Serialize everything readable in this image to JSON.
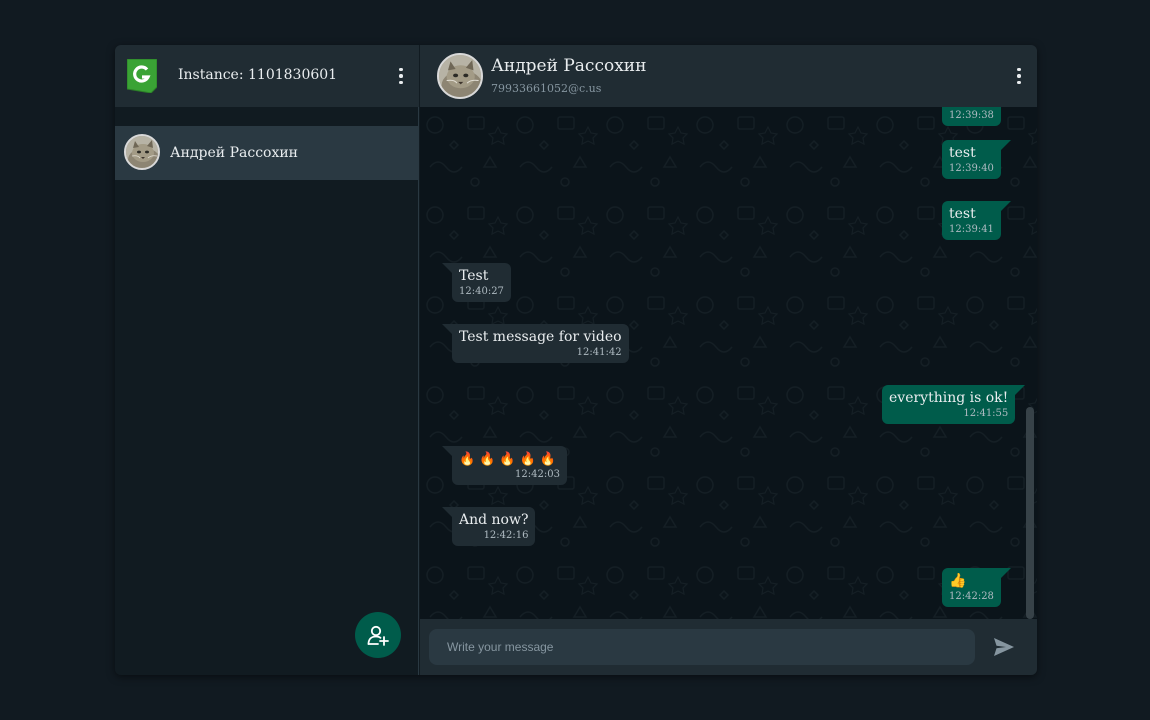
{
  "sidebar": {
    "instance_label": "Instance: 1101830601",
    "logo_icon": "green-api-logo",
    "menu_icon": "kebab-menu-icon",
    "chats": [
      {
        "name": "Андрей Рассохин",
        "avatar": "cat-avatar"
      }
    ],
    "add_contact_icon": "add-user-icon"
  },
  "chat": {
    "name": "Андрей Рассохин",
    "subtitle": "79933661052@c.us",
    "menu_icon": "kebab-menu-icon",
    "messages": [
      {
        "direction": "out",
        "text": "",
        "time": "12:39:38"
      },
      {
        "direction": "out",
        "text": "test",
        "time": "12:39:40"
      },
      {
        "direction": "out",
        "text": "test",
        "time": "12:39:41"
      },
      {
        "direction": "in",
        "text": "Test",
        "time": "12:40:27"
      },
      {
        "direction": "in",
        "text": "Test message for video",
        "time": "12:41:42"
      },
      {
        "direction": "out",
        "text": "everything is ok!",
        "time": "12:41:55"
      },
      {
        "direction": "in",
        "text": "🔥🔥🔥🔥🔥",
        "time": "12:42:03"
      },
      {
        "direction": "in",
        "text": "And now?",
        "time": "12:42:16"
      },
      {
        "direction": "out",
        "text": "👍",
        "time": "12:42:28"
      }
    ]
  },
  "composer": {
    "placeholder": "Write your message",
    "send_icon": "send-icon"
  },
  "colors": {
    "background": "#111a21",
    "panel": "#202c33",
    "outgoing_bubble": "#005c4b",
    "incoming_bubble": "#202c33",
    "accent": "#00a884"
  }
}
